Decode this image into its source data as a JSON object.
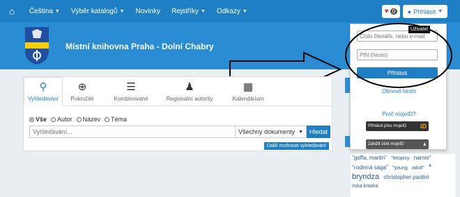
{
  "navbar": {
    "items": [
      {
        "label": "Čeština"
      },
      {
        "label": "Výběr katalogů"
      },
      {
        "label": "Novinky"
      },
      {
        "label": "Rejstříky"
      },
      {
        "label": "Odkazy"
      }
    ],
    "basket_count": "0",
    "login_label": "Přihlásit"
  },
  "header": {
    "library_name": "Místní knihovna Praha - Dolní Chabry"
  },
  "search": {
    "tabs": [
      {
        "label": "Vyhledávání",
        "icon": "search-icon"
      },
      {
        "label": "Pokročilé",
        "icon": "zoom-in-icon"
      },
      {
        "label": "Kombinované",
        "icon": "server-icon"
      },
      {
        "label": "Regionální autority",
        "icon": "user-icon"
      },
      {
        "label": "Kalendárium",
        "icon": "calendar-icon"
      }
    ],
    "radios": [
      {
        "label": "Vše"
      },
      {
        "label": "Autor"
      },
      {
        "label": "Název"
      },
      {
        "label": "Téma"
      }
    ],
    "placeholder": "Vyhledávání...",
    "doc_type": "Všechny dokumenty",
    "search_button": "Hledat",
    "more_options": "Další možnosti vyhledávání"
  },
  "login_dropdown": {
    "tooltip": "Uživatel",
    "reader_placeholder": "Číslo čtenáře, nebo e-mail",
    "pin_placeholder": "PIN (heslo)",
    "submit": "Přihlásit",
    "renew_password": "Obnovit heslo",
    "mojeid_question": "Proč mojeID?",
    "mojeid_login": "Přihlásit přes mojeID",
    "mojeid_create": "Založit účet mojeID",
    "mojeid_logo": "iD"
  },
  "tags": [
    {
      "label": "\"goffa, martin\""
    },
    {
      "label": "\"letopisy"
    },
    {
      "label": "narnie\""
    },
    {
      "label": "\"rodinná sága\""
    },
    {
      "label": "\"young"
    },
    {
      "label": "adult\""
    },
    {
      "label": "*"
    },
    {
      "label": "bryndza"
    },
    {
      "label": "christopher paolini"
    },
    {
      "label": "irska kraska"
    }
  ],
  "colors": {
    "brand_blue": "#1f7fc4",
    "header_blue": "#2a8dd4"
  }
}
